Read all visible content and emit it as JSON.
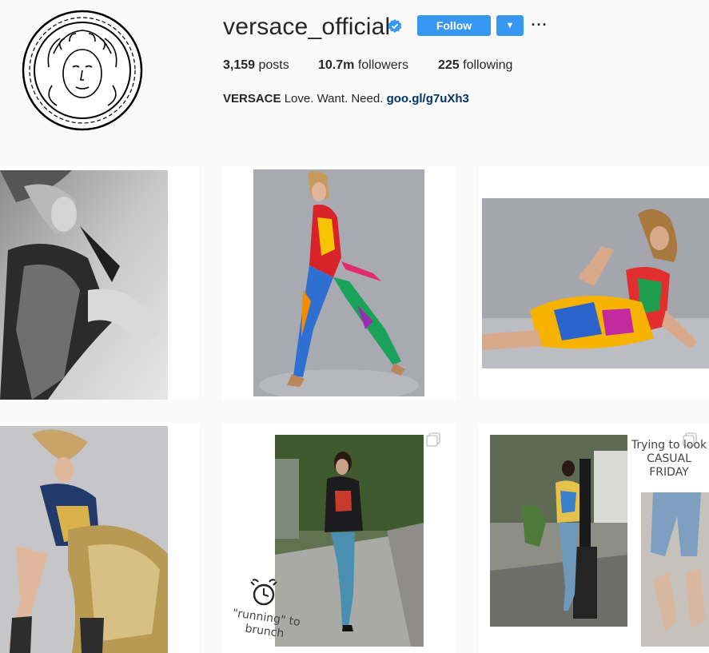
{
  "profile": {
    "username": "versace_official",
    "follow_label": "Follow",
    "stats": {
      "posts_count": "3,159",
      "posts_label": "posts",
      "followers_count": "10.7m",
      "followers_label": "followers",
      "following_count": "225",
      "following_label": "following"
    },
    "bio": {
      "name": "VERSACE",
      "text": "Love. Want. Need.",
      "link": "goo.gl/g7uXh3"
    }
  },
  "posts": [
    {
      "kind": "bw-editorial"
    },
    {
      "kind": "colorful-jumpsuit"
    },
    {
      "kind": "colorful-dress-seated"
    },
    {
      "kind": "lace-skirt-editorial"
    },
    {
      "kind": "street-style",
      "overlay": "\"running\" to brunch",
      "multi": true
    },
    {
      "kind": "casual-friday",
      "overlay": "Trying to look CASUAL FRIDAY",
      "multi": true
    }
  ],
  "colors": {
    "accent": "#3897f0",
    "link": "#003569",
    "background": "#fafafa"
  },
  "icons": [
    "versace-medusa-logo",
    "verified-badge-icon",
    "chevron-down-icon",
    "more-options-icon",
    "multiple-photos-icon",
    "alarm-clock-icon"
  ]
}
